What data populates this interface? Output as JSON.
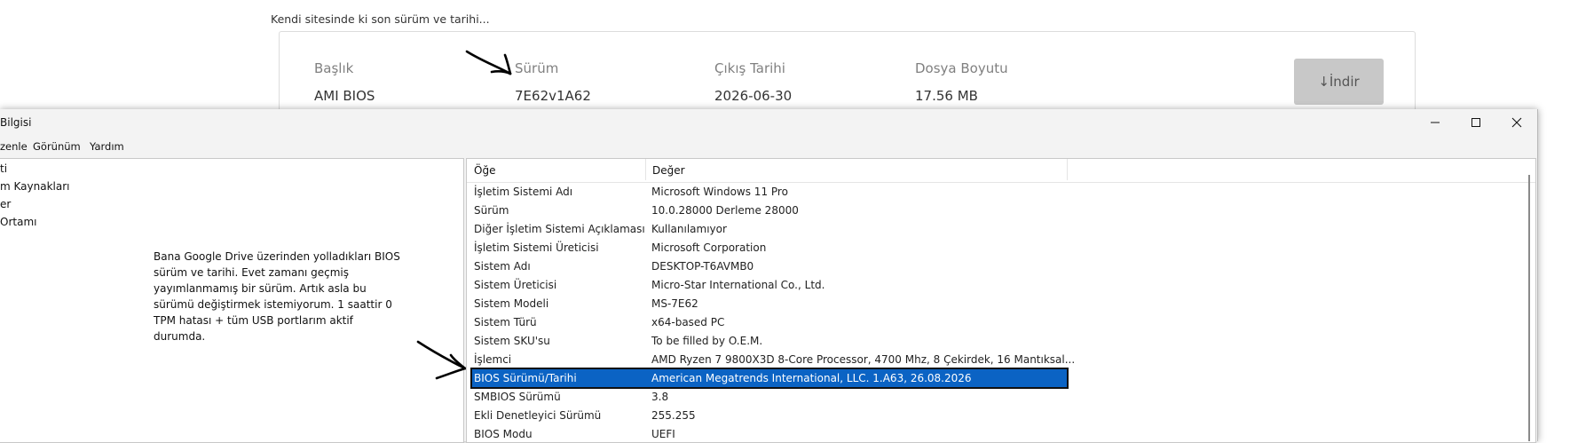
{
  "web": {
    "caption": "Kendi sitesinde ki son sürüm ve tarihi...",
    "card": {
      "headers": [
        "Başlık",
        "Sürüm",
        "Çıkış Tarihi",
        "Dosya Boyutu"
      ],
      "values": [
        "AMI BIOS",
        "7E62v1A62",
        "2026-06-30",
        "17.56 MB"
      ],
      "download_label": "↓İndir"
    }
  },
  "window": {
    "title": "Bilgisi",
    "menu": [
      "zenle",
      "Görünüm",
      "Yardım"
    ],
    "tree": [
      "ti",
      "m Kaynakları",
      "er",
      "Ortamı"
    ],
    "note": "Bana Google Drive üzerinden yolladıkları BIOS sürüm ve tarihi. Evet zamanı geçmiş yayımlanmamış bir sürüm. Artık asla bu sürümü değiştirmek istemiyorum. 1 saattir 0 TPM hatası + tüm USB portlarım aktif durumda.",
    "columns": {
      "item": "Öğe",
      "value": "Değer"
    },
    "rows": [
      {
        "item": "İşletim Sistemi Adı",
        "value": "Microsoft Windows 11 Pro"
      },
      {
        "item": "Sürüm",
        "value": "10.0.28000 Derleme 28000"
      },
      {
        "item": "Diğer İşletim Sistemi Açıklaması",
        "value": "Kullanılamıyor"
      },
      {
        "item": "İşletim Sistemi Üreticisi",
        "value": "Microsoft Corporation"
      },
      {
        "item": "Sistem Adı",
        "value": "DESKTOP-T6AVMB0"
      },
      {
        "item": "Sistem Üreticisi",
        "value": "Micro-Star International Co., Ltd."
      },
      {
        "item": "Sistem Modeli",
        "value": "MS-7E62"
      },
      {
        "item": "Sistem Türü",
        "value": "x64-based PC"
      },
      {
        "item": "Sistem SKU'su",
        "value": "To be filled by O.E.M."
      },
      {
        "item": "İşlemci",
        "value": "AMD Ryzen 7 9800X3D 8-Core Processor, 4700 Mhz, 8 Çekirdek, 16 Mantıksal..."
      },
      {
        "item": "BIOS Sürümü/Tarihi",
        "value": "American Megatrends International, LLC. 1.A63, 26.08.2026"
      },
      {
        "item": "SMBIOS Sürümü",
        "value": "3.8"
      },
      {
        "item": "Ekli Denetleyici Sürümü",
        "value": "255.255"
      },
      {
        "item": "BIOS Modu",
        "value": "UEFI"
      }
    ],
    "selected_row": "BIOS Sürümü/Tarihi"
  },
  "colors": {
    "selection": "#0b63c4",
    "download_button": "#c8c8c8"
  },
  "icons": [
    "minimize-icon",
    "maximize-icon",
    "close-icon",
    "arrow-annotation-icon"
  ]
}
